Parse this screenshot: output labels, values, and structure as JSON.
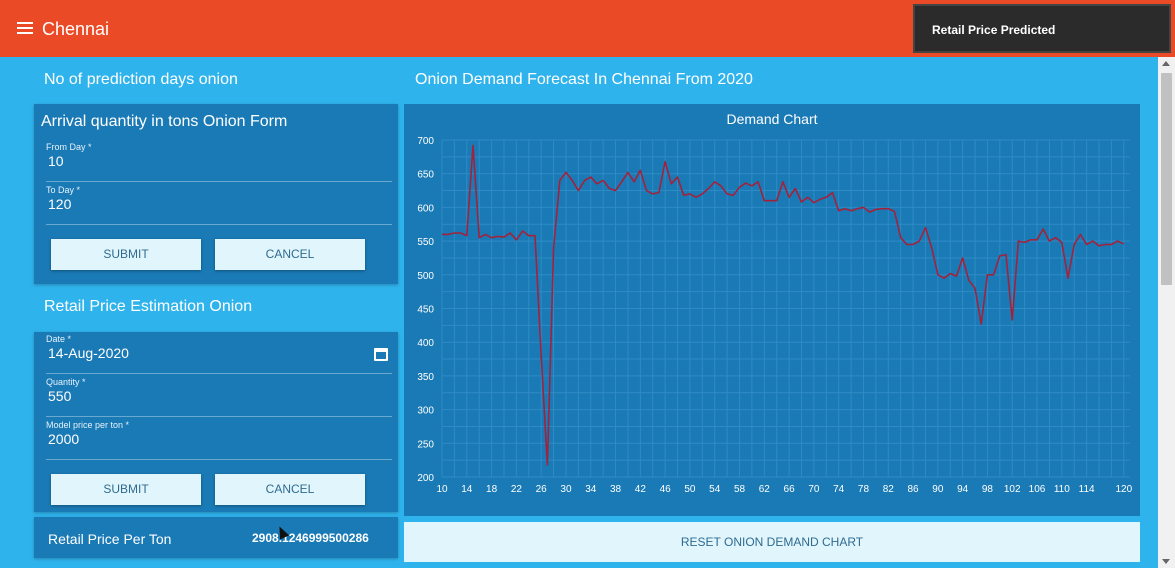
{
  "app": {
    "title": "Chennai",
    "toast": "Retail Price Predicted"
  },
  "prediction_days": {
    "heading": "No of prediction days onion",
    "form_title": "Arrival quantity in tons Onion Form",
    "from_day": {
      "label": "From Day *",
      "value": "10"
    },
    "to_day": {
      "label": "To Day *",
      "value": "120"
    },
    "submit_label": "SUBMIT",
    "cancel_label": "CANCEL"
  },
  "retail_estimation": {
    "heading": "Retail Price Estimation Onion",
    "date": {
      "label": "Date *",
      "value": "14-Aug-2020"
    },
    "quantity": {
      "label": "Quantity *",
      "value": "550"
    },
    "model_price": {
      "label": "Model price per ton *",
      "value": "2000"
    },
    "submit_label": "SUBMIT",
    "cancel_label": "CANCEL"
  },
  "result": {
    "label": "Retail Price Per Ton",
    "value": "2908.1246999500286"
  },
  "forecast": {
    "heading": "Onion Demand Forecast In Chennai From 2020",
    "reset_label": "RESET ONION DEMAND CHART"
  },
  "colors": {
    "appbar": "#ea4a25",
    "background": "#2fb3ec",
    "panel": "#1a7ab6",
    "line": "#a3223b",
    "button": "#e1f5fd"
  },
  "chart_data": {
    "type": "line",
    "title": "Demand Chart",
    "xlim": [
      10,
      121
    ],
    "ylim": [
      200,
      700
    ],
    "x_ticks": [
      10,
      14,
      18,
      22,
      26,
      30,
      34,
      38,
      42,
      46,
      50,
      54,
      58,
      62,
      66,
      70,
      74,
      78,
      82,
      86,
      90,
      94,
      98,
      102,
      106,
      110,
      114,
      120
    ],
    "y_ticks": [
      200,
      250,
      300,
      350,
      400,
      450,
      500,
      550,
      600,
      650,
      700
    ],
    "grid": true,
    "series": [
      {
        "x": [
          10,
          11,
          12,
          13,
          14,
          15,
          16,
          17,
          18,
          19,
          20,
          21,
          22,
          23,
          24,
          25,
          26,
          27,
          28,
          29,
          30,
          31,
          32,
          33,
          34,
          35,
          36,
          37,
          38,
          39,
          40,
          41,
          42,
          43,
          44,
          45,
          46,
          47,
          48,
          49,
          50,
          51,
          52,
          53,
          54,
          55,
          56,
          57,
          58,
          59,
          60,
          61,
          62,
          63,
          64,
          65,
          66,
          67,
          68,
          69,
          70,
          71,
          72,
          73,
          74,
          75,
          76,
          77,
          78,
          79,
          80,
          81,
          82,
          83,
          84,
          85,
          86,
          87,
          88,
          89,
          90,
          91,
          92,
          93,
          94,
          95,
          96,
          97,
          98,
          99,
          100,
          101,
          102,
          103,
          104,
          105,
          106,
          107,
          108,
          109,
          110,
          111,
          112,
          113,
          114,
          115,
          116,
          117,
          118,
          119,
          120
        ],
        "y": [
          560,
          560,
          562,
          562,
          558,
          692,
          555,
          560,
          555,
          557,
          556,
          562,
          552,
          565,
          558,
          558,
          380,
          218,
          540,
          640,
          652,
          640,
          625,
          640,
          645,
          635,
          640,
          628,
          625,
          638,
          652,
          638,
          655,
          625,
          620,
          622,
          668,
          635,
          645,
          618,
          620,
          615,
          620,
          628,
          638,
          632,
          620,
          618,
          630,
          636,
          632,
          638,
          610,
          610,
          610,
          638,
          615,
          628,
          608,
          615,
          607,
          612,
          615,
          622,
          595,
          598,
          595,
          598,
          600,
          593,
          597,
          598,
          598,
          594,
          555,
          545,
          545,
          550,
          570,
          540,
          500,
          495,
          502,
          498,
          525,
          492,
          480,
          427,
          500,
          500,
          528,
          530,
          433,
          550,
          548,
          552,
          552,
          568,
          550,
          555,
          548,
          495,
          545,
          560,
          545,
          550,
          543,
          545,
          545,
          550,
          546
        ]
      }
    ]
  }
}
